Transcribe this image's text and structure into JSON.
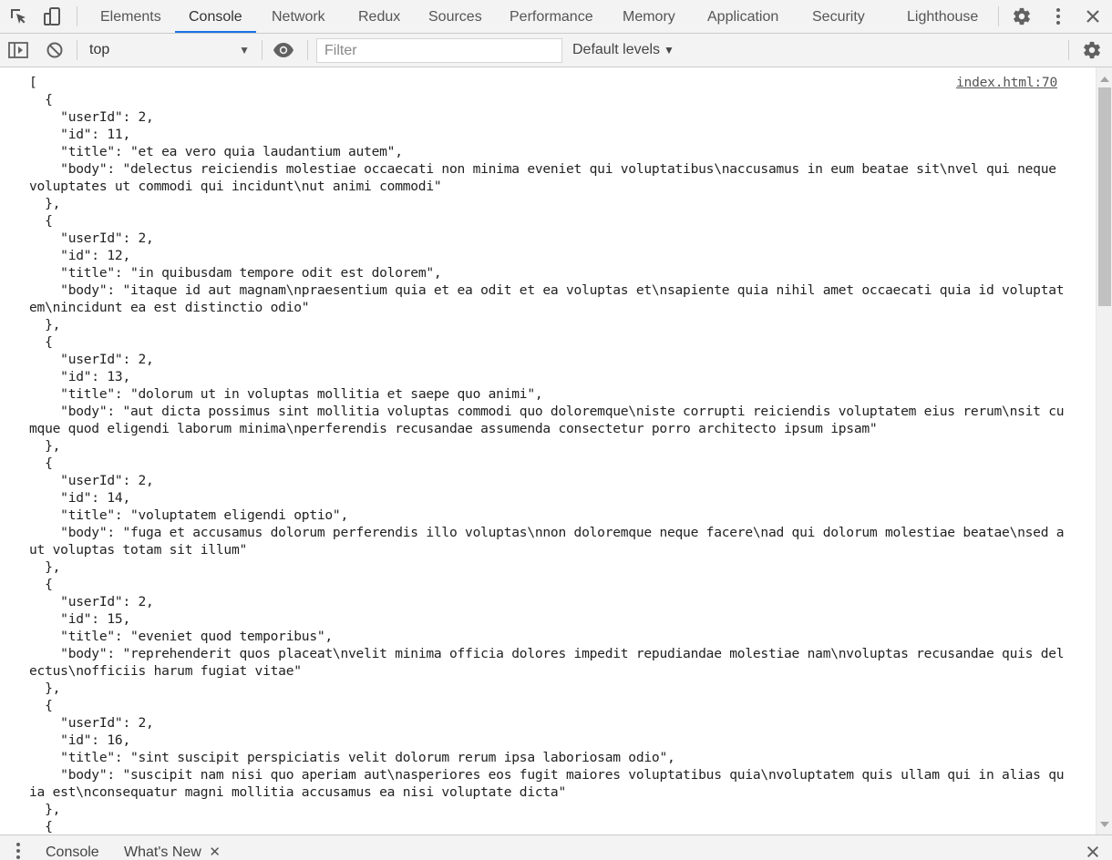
{
  "tabs": [
    {
      "label": "Elements"
    },
    {
      "label": "Console"
    },
    {
      "label": "Network"
    },
    {
      "label": "Redux"
    },
    {
      "label": "Sources"
    },
    {
      "label": "Performance"
    },
    {
      "label": "Memory"
    },
    {
      "label": "Application"
    },
    {
      "label": "Security"
    },
    {
      "label": "Lighthouse"
    }
  ],
  "active_tab": "Console",
  "icons": {
    "inspect": "inspect-element-icon",
    "device": "device-toolbar-icon",
    "settings": "gear-icon",
    "more": "kebab-menu-icon",
    "close": "close-icon",
    "sidebar": "sidebar-toggle-icon",
    "clear": "clear-console-icon",
    "eye": "eye-icon"
  },
  "toolbar": {
    "context": "top",
    "filter_placeholder": "Filter",
    "levels": "Default levels"
  },
  "console": {
    "source": "index.html:70",
    "output": "[\n  {\n    \"userId\": 2,\n    \"id\": 11,\n    \"title\": \"et ea vero quia laudantium autem\",\n    \"body\": \"delectus reiciendis molestiae occaecati non minima eveniet qui voluptatibus\\naccusamus in eum beatae sit\\nvel qui neque voluptates ut commodi qui incidunt\\nut animi commodi\"\n  },\n  {\n    \"userId\": 2,\n    \"id\": 12,\n    \"title\": \"in quibusdam tempore odit est dolorem\",\n    \"body\": \"itaque id aut magnam\\npraesentium quia et ea odit et ea voluptas et\\nsapiente quia nihil amet occaecati quia id voluptatem\\nincidunt ea est distinctio odio\"\n  },\n  {\n    \"userId\": 2,\n    \"id\": 13,\n    \"title\": \"dolorum ut in voluptas mollitia et saepe quo animi\",\n    \"body\": \"aut dicta possimus sint mollitia voluptas commodi quo doloremque\\niste corrupti reiciendis voluptatem eius rerum\\nsit cumque quod eligendi laborum minima\\nperferendis recusandae assumenda consectetur porro architecto ipsum ipsam\"\n  },\n  {\n    \"userId\": 2,\n    \"id\": 14,\n    \"title\": \"voluptatem eligendi optio\",\n    \"body\": \"fuga et accusamus dolorum perferendis illo voluptas\\nnon doloremque neque facere\\nad qui dolorum molestiae beatae\\nsed aut voluptas totam sit illum\"\n  },\n  {\n    \"userId\": 2,\n    \"id\": 15,\n    \"title\": \"eveniet quod temporibus\",\n    \"body\": \"reprehenderit quos placeat\\nvelit minima officia dolores impedit repudiandae molestiae nam\\nvoluptas recusandae quis delectus\\nofficiis harum fugiat vitae\"\n  },\n  {\n    \"userId\": 2,\n    \"id\": 16,\n    \"title\": \"sint suscipit perspiciatis velit dolorum rerum ipsa laboriosam odio\",\n    \"body\": \"suscipit nam nisi quo aperiam aut\\nasperiores eos fugit maiores voluptatibus quia\\nvoluptatem quis ullam qui in alias quia est\\nconsequatur magni mollitia accusamus ea nisi voluptate dicta\"\n  },\n  {"
  },
  "drawer": {
    "tabs": [
      {
        "label": "Console"
      },
      {
        "label": "What's New"
      }
    ]
  },
  "colors": {
    "accent": "#1a73e8",
    "toolbar_bg": "#f3f3f3",
    "border": "#cbcbcb"
  }
}
